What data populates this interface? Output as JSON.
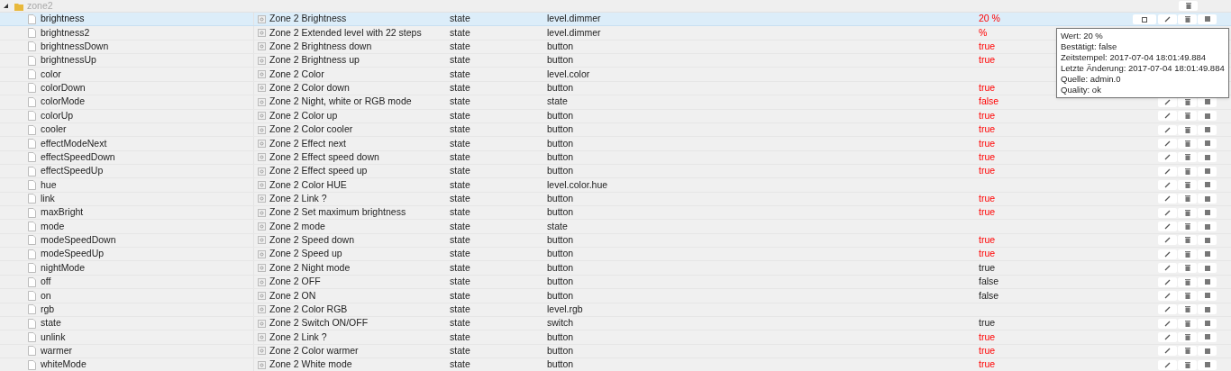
{
  "folder": {
    "name": "zone2",
    "expanded": true
  },
  "rows": [
    {
      "name": "brightness",
      "title": "Zone 2 Brightness",
      "type": "state",
      "role": "level.dimmer",
      "value": "20 %",
      "acked": false,
      "selected": true
    },
    {
      "name": "brightness2",
      "title": "Zone 2 Extended level with 22 steps",
      "type": "state",
      "role": "level.dimmer",
      "value": "%",
      "acked": false,
      "selected": false
    },
    {
      "name": "brightnessDown",
      "title": "Zone 2 Brightness down",
      "type": "state",
      "role": "button",
      "value": "true",
      "acked": false,
      "selected": false
    },
    {
      "name": "brightnessUp",
      "title": "Zone 2 Brightness up",
      "type": "state",
      "role": "button",
      "value": "true",
      "acked": false,
      "selected": false
    },
    {
      "name": "color",
      "title": "Zone 2 Color",
      "type": "state",
      "role": "level.color",
      "selected": false
    },
    {
      "name": "colorDown",
      "title": "Zone 2 Color down",
      "type": "state",
      "role": "button",
      "value": "true",
      "acked": false,
      "selected": false
    },
    {
      "name": "colorMode",
      "title": "Zone 2 Night, white or RGB mode",
      "type": "state",
      "role": "state",
      "value": "false",
      "acked": false,
      "selected": false
    },
    {
      "name": "colorUp",
      "title": "Zone 2 Color up",
      "type": "state",
      "role": "button",
      "value": "true",
      "acked": false,
      "selected": false
    },
    {
      "name": "cooler",
      "title": "Zone 2 Color cooler",
      "type": "state",
      "role": "button",
      "value": "true",
      "acked": false,
      "selected": false
    },
    {
      "name": "effectModeNext",
      "title": "Zone 2 Effect next",
      "type": "state",
      "role": "button",
      "value": "true",
      "acked": false,
      "selected": false
    },
    {
      "name": "effectSpeedDown",
      "title": "Zone 2 Effect speed down",
      "type": "state",
      "role": "button",
      "value": "true",
      "acked": false,
      "selected": false
    },
    {
      "name": "effectSpeedUp",
      "title": "Zone 2 Effect speed up",
      "type": "state",
      "role": "button",
      "value": "true",
      "acked": false,
      "selected": false
    },
    {
      "name": "hue",
      "title": "Zone 2 Color HUE",
      "type": "state",
      "role": "level.color.hue",
      "selected": false
    },
    {
      "name": "link",
      "title": "Zone 2 Link ?",
      "type": "state",
      "role": "button",
      "value": "true",
      "acked": false,
      "selected": false
    },
    {
      "name": "maxBright",
      "title": "Zone 2 Set maximum brightness",
      "type": "state",
      "role": "button",
      "value": "true",
      "acked": false,
      "selected": false
    },
    {
      "name": "mode",
      "title": "Zone 2 mode",
      "type": "state",
      "role": "state",
      "selected": false
    },
    {
      "name": "modeSpeedDown",
      "title": "Zone 2 Speed down",
      "type": "state",
      "role": "button",
      "value": "true",
      "acked": false,
      "selected": false
    },
    {
      "name": "modeSpeedUp",
      "title": "Zone 2 Speed up",
      "type": "state",
      "role": "button",
      "value": "true",
      "acked": false,
      "selected": false
    },
    {
      "name": "nightMode",
      "title": "Zone 2 Night mode",
      "type": "state",
      "role": "button",
      "value": "true",
      "acked": true,
      "selected": false
    },
    {
      "name": "off",
      "title": "Zone 2 OFF",
      "type": "state",
      "role": "button",
      "value": "false",
      "acked": true,
      "selected": false
    },
    {
      "name": "on",
      "title": "Zone 2 ON",
      "type": "state",
      "role": "button",
      "value": "false",
      "acked": true,
      "selected": false
    },
    {
      "name": "rgb",
      "title": "Zone 2 Color RGB",
      "type": "state",
      "role": "level.rgb",
      "selected": false
    },
    {
      "name": "state",
      "title": "Zone 2 Switch ON/OFF",
      "type": "state",
      "role": "switch",
      "value": "true",
      "acked": true,
      "selected": false
    },
    {
      "name": "unlink",
      "title": "Zone 2 Link ?",
      "type": "state",
      "role": "button",
      "value": "true",
      "acked": false,
      "selected": false
    },
    {
      "name": "warmer",
      "title": "Zone 2 Color warmer",
      "type": "state",
      "role": "button",
      "value": "true",
      "acked": false,
      "selected": false
    },
    {
      "name": "whiteMode",
      "title": "Zone 2 White mode",
      "type": "state",
      "role": "button",
      "value": "true",
      "acked": false,
      "selected": false
    }
  ],
  "tooltip": [
    "Wert: 20 %",
    "Bestätigt: false",
    "Zeitstempel: 2017-07-04 18:01:49.884",
    "Letzte Änderung: 2017-07-04 18:01:49.884",
    "Quelle: admin.0",
    "Quality: ok"
  ]
}
